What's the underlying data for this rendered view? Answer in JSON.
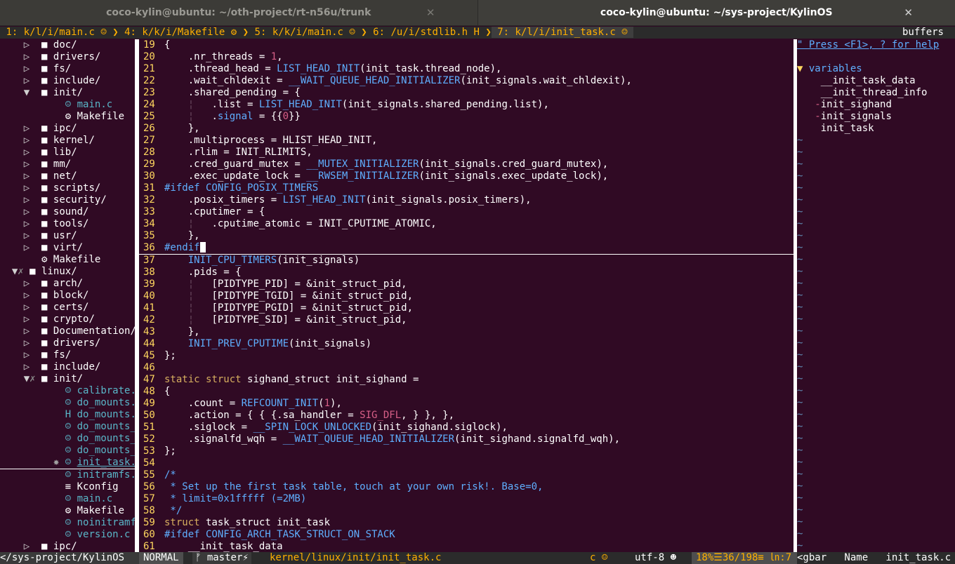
{
  "terminal_tabs": [
    {
      "title": "coco-kylin@ubuntu: ~/oth-project/rt-n56u/trunk",
      "active": false
    },
    {
      "title": "coco-kylin@ubuntu: ~/sys-project/KylinOS",
      "active": true
    }
  ],
  "close_glyph": "✕",
  "buffer_tabs": [
    {
      "label": "1: k/l/i/main.c",
      "icon": "☺"
    },
    {
      "label": "4: k/k/i/Makefile",
      "icon": "⚙"
    },
    {
      "label": "5: k/k/i/main.c",
      "icon": "☺"
    },
    {
      "label": "6: /u/i/stdlib.h",
      "icon": "H"
    },
    {
      "label": "7: k/l/i/init_task.c",
      "icon": "☺"
    }
  ],
  "buffers_label": "buffers",
  "tree": [
    {
      "indent": 2,
      "arrow": "▷",
      "type": "folder",
      "name": "doc/"
    },
    {
      "indent": 2,
      "arrow": "▷",
      "type": "folder",
      "name": "drivers/"
    },
    {
      "indent": 2,
      "arrow": "▷",
      "type": "folder",
      "name": "fs/"
    },
    {
      "indent": 2,
      "arrow": "▷",
      "type": "folder",
      "name": "include/"
    },
    {
      "indent": 2,
      "arrow": "▼",
      "type": "folder",
      "name": "init/"
    },
    {
      "indent": 5,
      "arrow": "",
      "type": "c",
      "name": "main.c"
    },
    {
      "indent": 5,
      "arrow": "",
      "type": "gear",
      "name": "Makefile"
    },
    {
      "indent": 2,
      "arrow": "▷",
      "type": "folder",
      "name": "ipc/"
    },
    {
      "indent": 2,
      "arrow": "▷",
      "type": "folder",
      "name": "kernel/"
    },
    {
      "indent": 2,
      "arrow": "▷",
      "type": "folder",
      "name": "lib/"
    },
    {
      "indent": 2,
      "arrow": "▷",
      "type": "folder",
      "name": "mm/"
    },
    {
      "indent": 2,
      "arrow": "▷",
      "type": "folder",
      "name": "net/"
    },
    {
      "indent": 2,
      "arrow": "▷",
      "type": "folder",
      "name": "scripts/"
    },
    {
      "indent": 2,
      "arrow": "▷",
      "type": "folder",
      "name": "security/"
    },
    {
      "indent": 2,
      "arrow": "▷",
      "type": "folder",
      "name": "sound/"
    },
    {
      "indent": 2,
      "arrow": "▷",
      "type": "folder",
      "name": "tools/"
    },
    {
      "indent": 2,
      "arrow": "▷",
      "type": "folder",
      "name": "usr/"
    },
    {
      "indent": 2,
      "arrow": "▷",
      "type": "folder",
      "name": "virt/"
    },
    {
      "indent": 3,
      "arrow": "",
      "type": "gear",
      "name": "Makefile"
    },
    {
      "indent": 1,
      "arrow": "▼",
      "type": "folder",
      "name": "linux/",
      "mark": "✗"
    },
    {
      "indent": 2,
      "arrow": "▷",
      "type": "folder",
      "name": "arch/"
    },
    {
      "indent": 2,
      "arrow": "▷",
      "type": "folder",
      "name": "block/"
    },
    {
      "indent": 2,
      "arrow": "▷",
      "type": "folder",
      "name": "certs/"
    },
    {
      "indent": 2,
      "arrow": "▷",
      "type": "folder",
      "name": "crypto/"
    },
    {
      "indent": 2,
      "arrow": "▷",
      "type": "folder",
      "name": "Documentation/"
    },
    {
      "indent": 2,
      "arrow": "▷",
      "type": "folder",
      "name": "drivers/"
    },
    {
      "indent": 2,
      "arrow": "▷",
      "type": "folder",
      "name": "fs/"
    },
    {
      "indent": 2,
      "arrow": "▷",
      "type": "folder",
      "name": "include/"
    },
    {
      "indent": 2,
      "arrow": "▼",
      "type": "folder",
      "name": "init/",
      "mark": "✗"
    },
    {
      "indent": 5,
      "arrow": "",
      "type": "c",
      "name": "calibrate.c"
    },
    {
      "indent": 5,
      "arrow": "",
      "type": "c",
      "name": "do_mounts.c"
    },
    {
      "indent": 5,
      "arrow": "",
      "type": "h",
      "name": "do_mounts.h"
    },
    {
      "indent": 5,
      "arrow": "",
      "type": "c",
      "name": "do_mounts_in"
    },
    {
      "indent": 5,
      "arrow": "",
      "type": "c",
      "name": "do_mounts_md"
    },
    {
      "indent": 5,
      "arrow": "",
      "type": "c",
      "name": "do_mounts_rd"
    },
    {
      "indent": 5,
      "arrow": "",
      "type": "c",
      "name": "init_task.c",
      "current": true
    },
    {
      "indent": 5,
      "arrow": "",
      "type": "c",
      "name": "initramfs.c"
    },
    {
      "indent": 5,
      "arrow": "",
      "type": "k",
      "name": "Kconfig"
    },
    {
      "indent": 5,
      "arrow": "",
      "type": "c",
      "name": "main.c"
    },
    {
      "indent": 5,
      "arrow": "",
      "type": "gear",
      "name": "Makefile"
    },
    {
      "indent": 5,
      "arrow": "",
      "type": "c",
      "name": "noinitramfs."
    },
    {
      "indent": 5,
      "arrow": "",
      "type": "c",
      "name": "version.c"
    },
    {
      "indent": 2,
      "arrow": "▷",
      "type": "folder",
      "name": "ipc/"
    }
  ],
  "code": [
    {
      "n": "19",
      "s": [
        [
          "{",
          ""
        ]
      ]
    },
    {
      "n": "20",
      "s": [
        [
          "    .nr_threads = ",
          ""
        ],
        [
          "1",
          "num"
        ],
        [
          ",",
          ""
        ]
      ]
    },
    {
      "n": "21",
      "s": [
        [
          "    .thread_head = ",
          ""
        ],
        [
          "LIST_HEAD_INIT",
          "macro"
        ],
        [
          "(init_task.thread_node),",
          ""
        ]
      ]
    },
    {
      "n": "22",
      "s": [
        [
          "    .wait_chldexit = ",
          ""
        ],
        [
          "__WAIT_QUEUE_HEAD_INITIALIZER",
          "macro"
        ],
        [
          "(init_signals.wait_chldexit),",
          ""
        ]
      ]
    },
    {
      "n": "23",
      "s": [
        [
          "    .shared_pending = {",
          ""
        ]
      ]
    },
    {
      "n": "24",
      "s": [
        [
          "    ",
          "guide"
        ],
        [
          "¦",
          "guide"
        ],
        [
          "   .list = ",
          ""
        ],
        [
          "LIST_HEAD_INIT",
          "macro"
        ],
        [
          "(init_signals.shared_pending.list),",
          ""
        ]
      ]
    },
    {
      "n": "25",
      "s": [
        [
          "    ",
          "guide"
        ],
        [
          "¦",
          "guide"
        ],
        [
          "   .",
          ""
        ],
        [
          "signal",
          "macro"
        ],
        [
          " = {{",
          ""
        ],
        [
          "0",
          "num"
        ],
        [
          "}}",
          ""
        ]
      ]
    },
    {
      "n": "26",
      "s": [
        [
          "    },",
          ""
        ]
      ]
    },
    {
      "n": "27",
      "s": [
        [
          "    .multiprocess = HLIST_HEAD_INIT,",
          ""
        ]
      ]
    },
    {
      "n": "28",
      "s": [
        [
          "    .rlim = INIT_RLIMITS,",
          ""
        ]
      ]
    },
    {
      "n": "29",
      "s": [
        [
          "    .cred_guard_mutex = ",
          ""
        ],
        [
          "__MUTEX_INITIALIZER",
          "macro"
        ],
        [
          "(init_signals.cred_guard_mutex),",
          ""
        ]
      ]
    },
    {
      "n": "30",
      "s": [
        [
          "    .exec_update_lock = ",
          ""
        ],
        [
          "__RWSEM_INITIALIZER",
          "macro"
        ],
        [
          "(init_signals.exec_update_lock),",
          ""
        ]
      ]
    },
    {
      "n": "31",
      "s": [
        [
          "#ifdef CONFIG_POSIX_TIMERS",
          "pp"
        ]
      ]
    },
    {
      "n": "32",
      "s": [
        [
          "    .posix_timers = ",
          ""
        ],
        [
          "LIST_HEAD_INIT",
          "macro"
        ],
        [
          "(init_signals.posix_timers),",
          ""
        ]
      ]
    },
    {
      "n": "33",
      "s": [
        [
          "    .cputimer = {",
          ""
        ]
      ]
    },
    {
      "n": "34",
      "s": [
        [
          "    ",
          "guide"
        ],
        [
          "¦",
          "guide"
        ],
        [
          "   .cputime_atomic = INIT_CPUTIME_ATOMIC,",
          ""
        ]
      ]
    },
    {
      "n": "35",
      "s": [
        [
          "    },",
          ""
        ]
      ]
    },
    {
      "n": "36",
      "s": [
        [
          "#endif",
          "pp"
        ]
      ],
      "cursor": true
    },
    {
      "n": "37",
      "s": [
        [
          "    ",
          ""
        ],
        [
          "INIT_CPU_TIMERS",
          "macro"
        ],
        [
          "(init_signals)",
          ""
        ]
      ]
    },
    {
      "n": "38",
      "s": [
        [
          "    .pids = {",
          ""
        ]
      ]
    },
    {
      "n": "39",
      "s": [
        [
          "    ",
          "guide"
        ],
        [
          "¦",
          "guide"
        ],
        [
          "   [PIDTYPE_PID] = &init_struct_pid,",
          ""
        ]
      ]
    },
    {
      "n": "40",
      "s": [
        [
          "    ",
          "guide"
        ],
        [
          "¦",
          "guide"
        ],
        [
          "   [PIDTYPE_TGID] = &init_struct_pid,",
          ""
        ]
      ]
    },
    {
      "n": "41",
      "s": [
        [
          "    ",
          "guide"
        ],
        [
          "¦",
          "guide"
        ],
        [
          "   [PIDTYPE_PGID] = &init_struct_pid,",
          ""
        ]
      ]
    },
    {
      "n": "42",
      "s": [
        [
          "    ",
          "guide"
        ],
        [
          "¦",
          "guide"
        ],
        [
          "   [PIDTYPE_SID] = &init_struct_pid,",
          ""
        ]
      ]
    },
    {
      "n": "43",
      "s": [
        [
          "    },",
          ""
        ]
      ]
    },
    {
      "n": "44",
      "s": [
        [
          "    ",
          ""
        ],
        [
          "INIT_PREV_CPUTIME",
          "macro"
        ],
        [
          "(init_signals)",
          ""
        ]
      ]
    },
    {
      "n": "45",
      "s": [
        [
          "};",
          ""
        ]
      ]
    },
    {
      "n": "46",
      "s": [
        [
          "",
          ""
        ]
      ]
    },
    {
      "n": "47",
      "s": [
        [
          "static",
          "kw"
        ],
        [
          " ",
          ""
        ],
        [
          "struct",
          "kw"
        ],
        [
          " sighand_struct init_sighand =",
          ""
        ]
      ]
    },
    {
      "n": "48",
      "s": [
        [
          "{",
          ""
        ]
      ]
    },
    {
      "n": "49",
      "s": [
        [
          "    .count = ",
          ""
        ],
        [
          "REFCOUNT_INIT",
          "macro"
        ],
        [
          "(",
          ""
        ],
        [
          "1",
          "num"
        ],
        [
          "),",
          ""
        ]
      ]
    },
    {
      "n": "50",
      "s": [
        [
          "    .action = { { {.sa_handler = ",
          ""
        ],
        [
          "SIG_DFL",
          "sym"
        ],
        [
          ", } }, },",
          ""
        ]
      ]
    },
    {
      "n": "51",
      "s": [
        [
          "    .siglock = ",
          ""
        ],
        [
          "__SPIN_LOCK_UNLOCKED",
          "macro"
        ],
        [
          "(init_sighand.siglock),",
          ""
        ]
      ]
    },
    {
      "n": "52",
      "s": [
        [
          "    .signalfd_wqh = ",
          ""
        ],
        [
          "__WAIT_QUEUE_HEAD_INITIALIZER",
          "macro"
        ],
        [
          "(init_sighand.signalfd_wqh),",
          ""
        ]
      ]
    },
    {
      "n": "53",
      "s": [
        [
          "};",
          ""
        ]
      ]
    },
    {
      "n": "54",
      "s": [
        [
          "",
          ""
        ]
      ]
    },
    {
      "n": "55",
      "s": [
        [
          "/*",
          "cm"
        ]
      ]
    },
    {
      "n": "56",
      "s": [
        [
          " * Set up the first task table, touch at your own risk!. Base=0,",
          "cm"
        ]
      ]
    },
    {
      "n": "57",
      "s": [
        [
          " * limit=0x1fffff (=2MB)",
          "cm"
        ]
      ]
    },
    {
      "n": "58",
      "s": [
        [
          " */",
          "cm"
        ]
      ]
    },
    {
      "n": "59",
      "s": [
        [
          "struct",
          "kw"
        ],
        [
          " task_struct init_task",
          ""
        ]
      ]
    },
    {
      "n": "60",
      "s": [
        [
          "#ifdef CONFIG_ARCH_TASK_STRUCT_ON_STACK",
          "pp"
        ]
      ]
    },
    {
      "n": "61",
      "s": [
        [
          "    __init_task_data",
          ""
        ]
      ]
    }
  ],
  "tagbar": {
    "help": "\" Press <F1>, ? for help",
    "category": "variables",
    "items": [
      {
        "prefix": " ",
        "name": "__init_task_data"
      },
      {
        "prefix": " ",
        "name": "__init_thread_info"
      },
      {
        "prefix": "-",
        "name": "init_sighand"
      },
      {
        "prefix": "-",
        "name": "init_signals"
      },
      {
        "prefix": " ",
        "name": "init_task"
      }
    ],
    "tilde": "~"
  },
  "status": {
    "cwd": "</sys-project/KylinOS",
    "mode": "NORMAL",
    "branch": "ᚠ master⚡",
    "file": "kernel/linux/init/init_task.c",
    "filetype": "c ☺",
    "encoding": "utf-8 ☻",
    "position": "18%☰36/198≡ ㏑:7",
    "tagbar": "<gbar   Name   init_task.c"
  }
}
